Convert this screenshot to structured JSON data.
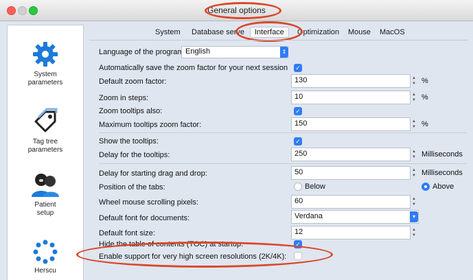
{
  "window": {
    "title": "General options"
  },
  "tabs": [
    "System",
    "Database serve",
    "Interface",
    "Optimization",
    "Mouse",
    "MacOS"
  ],
  "active_tab": "Interface",
  "sidebar": {
    "items": [
      {
        "label": "System\nparameters",
        "icon": "gear-icon"
      },
      {
        "label": "Tag tree\nparameters",
        "icon": "tag-icon"
      },
      {
        "label": "Patient\nsetup",
        "icon": "patients-icon"
      },
      {
        "label": "Herscu",
        "icon": "circle-dots-icon"
      }
    ]
  },
  "settings": {
    "language_label": "Language of the program:",
    "language_value": "English",
    "autosave_zoom_label": "Automatically save the zoom factor for your next session",
    "default_zoom_label": "Default zoom factor:",
    "default_zoom_value": "130",
    "zoom_steps_label": "Zoom in steps:",
    "zoom_steps_value": "10",
    "zoom_tooltips_label": "Zoom tooltips also:",
    "max_tooltips_zoom_label": "Maximum tooltips zoom factor:",
    "max_tooltips_zoom_value": "150",
    "show_tooltips_label": "Show the tooltips:",
    "delay_tooltips_label": "Delay for the tooltips:",
    "delay_tooltips_value": "250",
    "delay_drag_label": "Delay for starting drag and drop:",
    "delay_drag_value": "50",
    "tabs_position_label": "Position of the tabs:",
    "tabs_position_below": "Below",
    "tabs_position_above": "Above",
    "wheel_scroll_label": "Wheel mouse scrolling pixels:",
    "wheel_scroll_value": "60",
    "default_font_label": "Default font for documents:",
    "default_font_value": "Verdana",
    "default_font_size_label": "Default font size:",
    "default_font_size_value": "12",
    "hide_toc_label": "Hide the table of contents (TOC) at startup:",
    "high_res_label": "Enable support for very high screen resolutions (2K/4K):"
  },
  "units": {
    "percent": "%",
    "ms": "Milliseconds"
  },
  "accent_color": "#2f7cf6",
  "highlight_color": "#d9482b"
}
